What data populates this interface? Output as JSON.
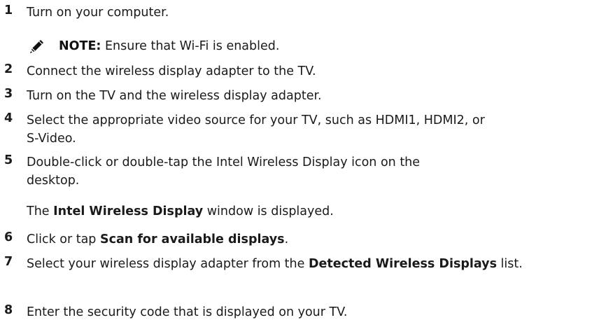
{
  "steps": [
    {
      "num": "1",
      "text": "Turn on your computer."
    },
    {
      "num": "2",
      "text": "Connect the wireless display adapter to the TV."
    },
    {
      "num": "3",
      "text": "Turn on the TV and the wireless display adapter."
    },
    {
      "num": "4",
      "text": "Select the appropriate video source for your TV, such as HDMI1, HDMI2, or S-Video."
    },
    {
      "num": "5",
      "text": "Double-click or double-tap the Intel Wireless Display icon on the desktop."
    },
    {
      "num": "6",
      "text_before": "Click or tap ",
      "text_bold": "Scan for available displays",
      "text_after": "."
    },
    {
      "num": "7",
      "text_before": "Select your wireless display adapter from the ",
      "text_bold": "Detected Wireless Displays",
      "text_after": " list."
    },
    {
      "num": "8",
      "text": "Enter the security code that is displayed on your TV."
    }
  ],
  "note": {
    "icon": "pencil-note-icon",
    "label": "NOTE:",
    "text": " Ensure that Wi-Fi is enabled."
  },
  "step5_result": {
    "before": "The ",
    "bold": "Intel Wireless Display",
    "after": " window is displayed."
  }
}
